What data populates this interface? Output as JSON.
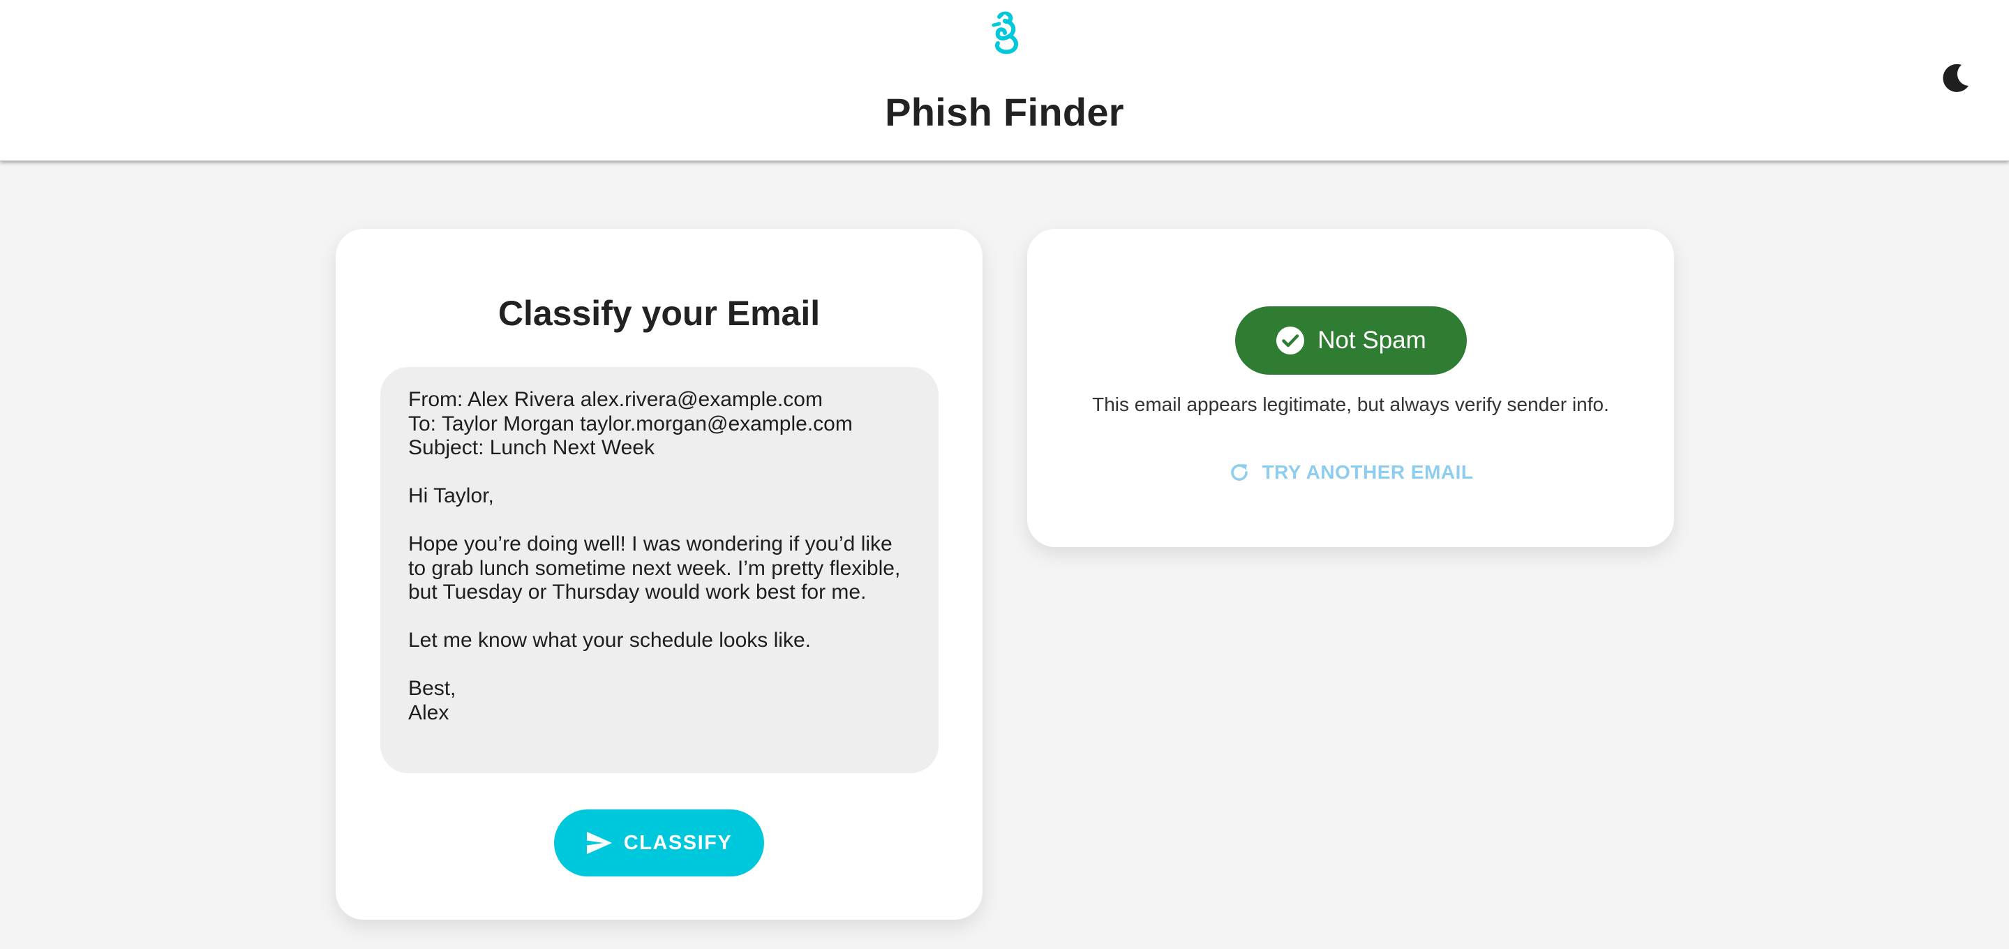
{
  "header": {
    "title": "Phish Finder",
    "logo_icon": "seahorse-logo-icon",
    "theme_toggle_icon": "moon-icon",
    "accent_color": "#00c8dc"
  },
  "classify_card": {
    "title": "Classify your Email",
    "email_text": "From: Alex Rivera alex.rivera@example.com\nTo: Taylor Morgan taylor.morgan@example.com\nSubject: Lunch Next Week\n\nHi Taylor,\n\nHope you’re doing well! I was wondering if you’d like to grab lunch sometime next week. I’m pretty flexible, but Tuesday or Thursday would work best for me.\n\nLet me know what your schedule looks like.\n\nBest,\nAlex",
    "classify_button": {
      "label": "CLASSIFY",
      "icon": "send-icon",
      "color": "#00c8dc"
    }
  },
  "result_card": {
    "badge": {
      "label": "Not Spam",
      "icon": "check-circle-icon",
      "color": "#2e7d32"
    },
    "message": "This email appears legitimate, but always verify sender info.",
    "try_again_button": {
      "label": "TRY ANOTHER EMAIL",
      "icon": "refresh-icon",
      "color": "#8fcdf0"
    }
  }
}
